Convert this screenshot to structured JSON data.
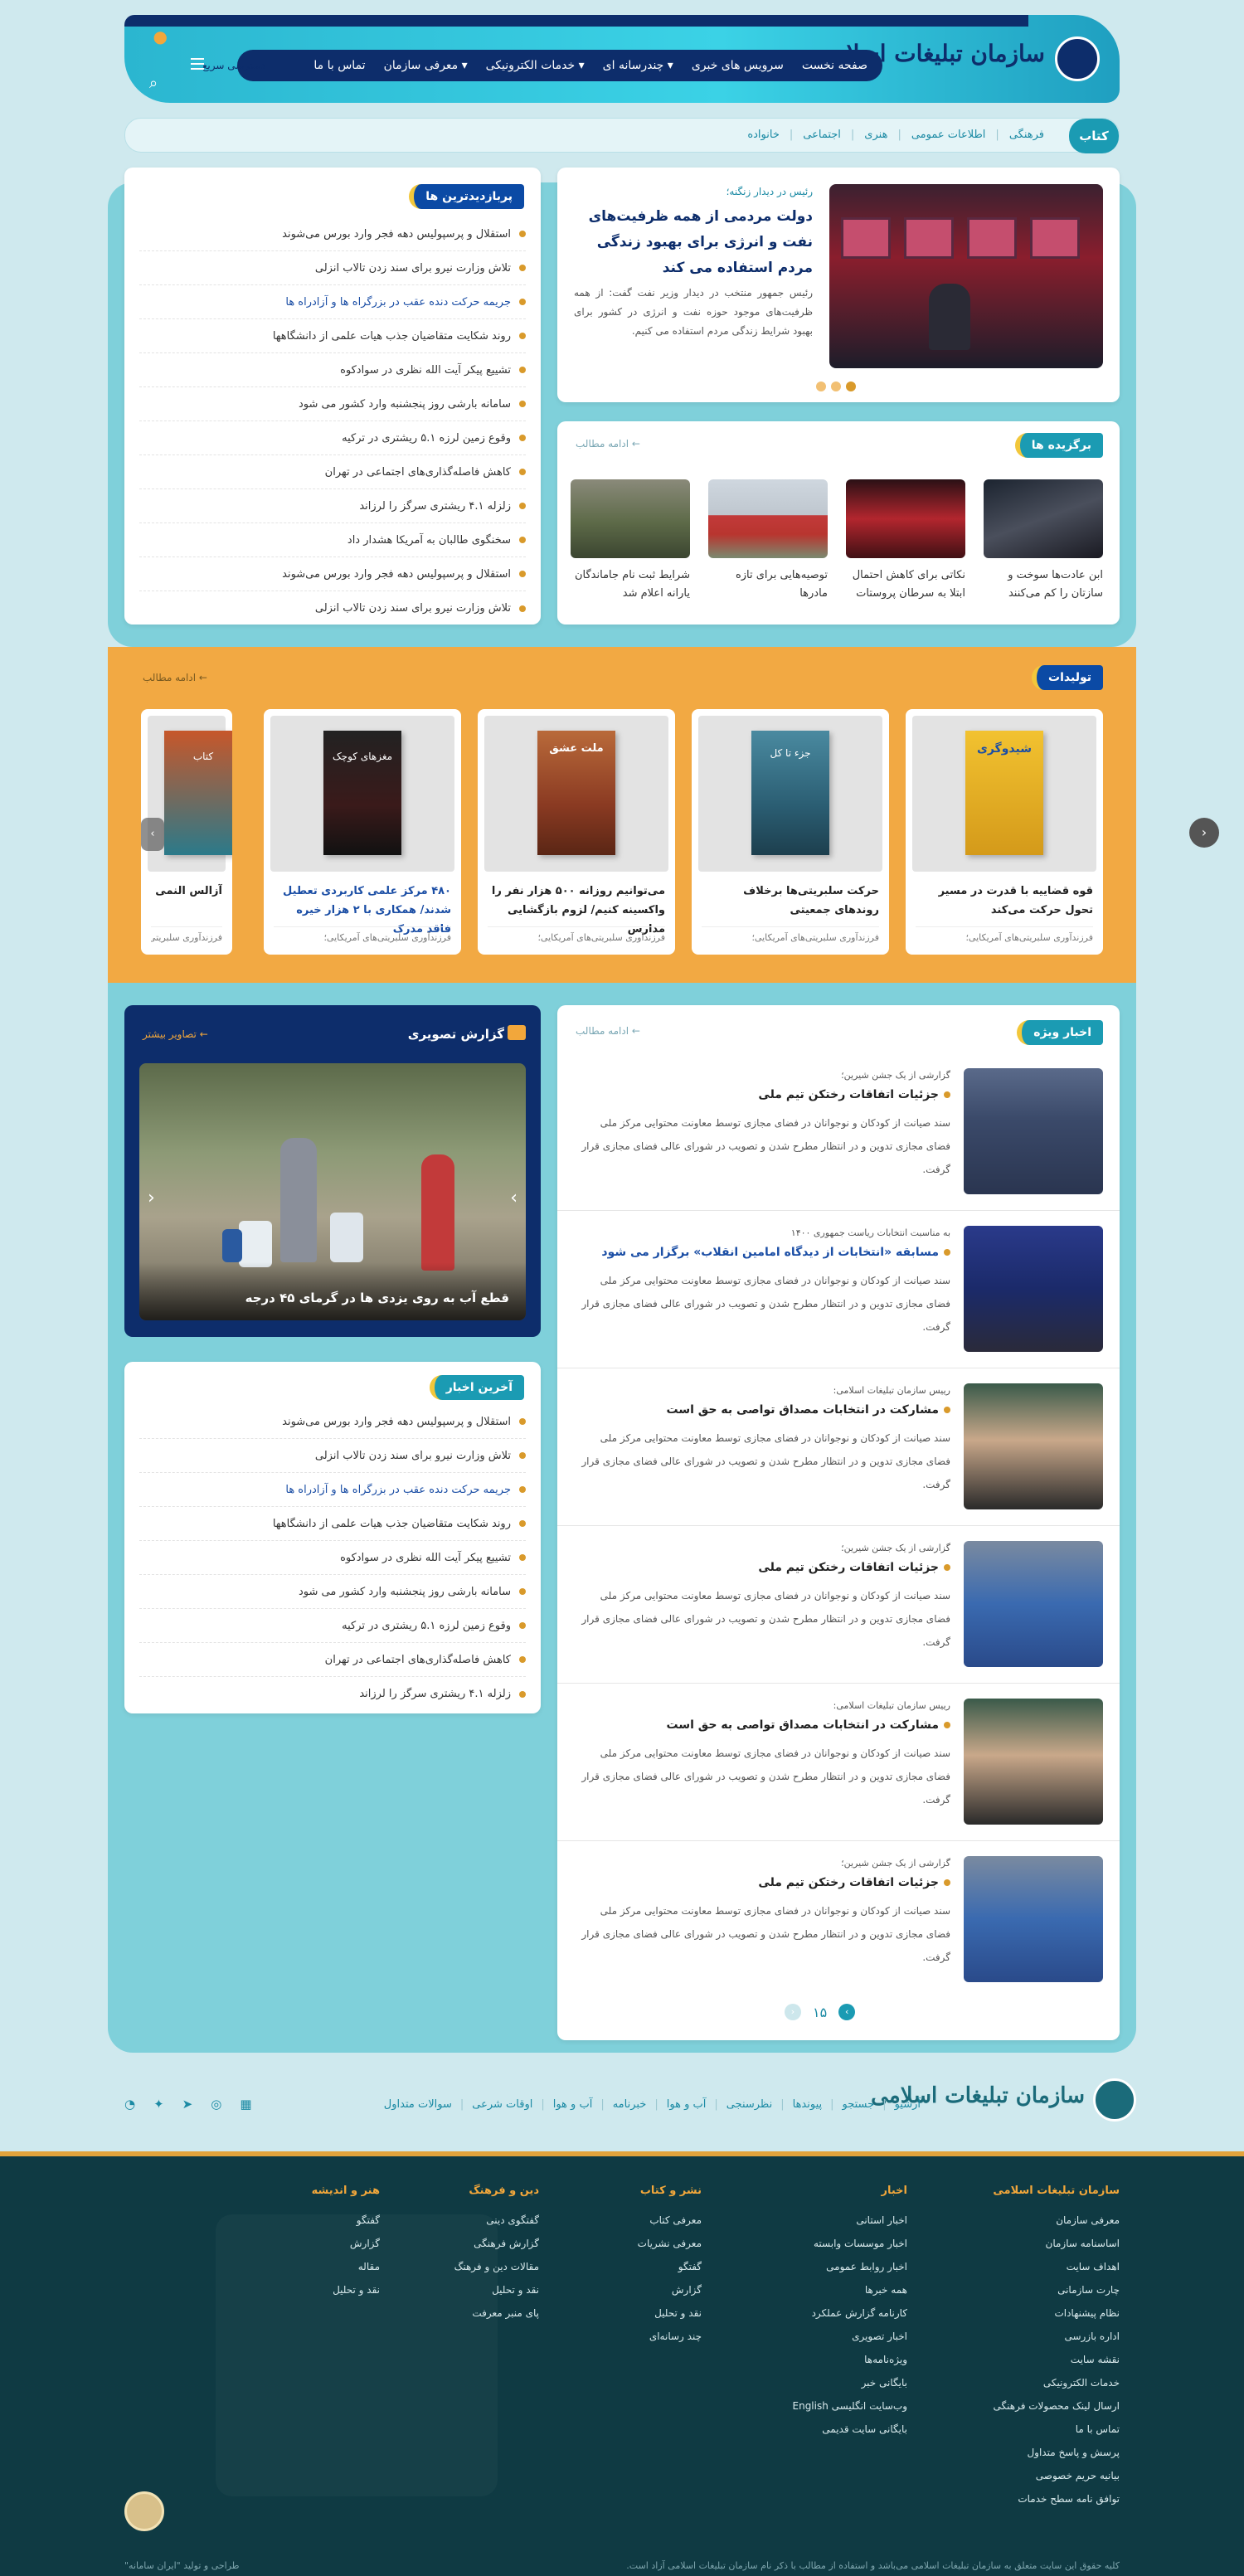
{
  "header": {
    "logo_text": "سازمان تبلیغات اسلامی",
    "nav": [
      "صفحه نخست",
      "سرویس های خبری",
      "چندرسانه ای",
      "خدمات الکترونیکی",
      "معرفی سازمان",
      "تماس با ما"
    ],
    "quick_access": "دسترسی سریع"
  },
  "subnav": {
    "head": "کتاب",
    "links": [
      "فرهنگی",
      "اطلاعات عمومی",
      "هنری",
      "اجتماعی",
      "خانواده"
    ]
  },
  "hero": {
    "kicker": "رئیس در دیدار زنگنه؛",
    "title": "دولت مردمی از همه ظرفیت‌های نفت و انرژی برای بهبود زندگی مردم استفاده می کند",
    "desc": "رئیس جمهور منتخب در دیدار وزیر نفت گفت: از همه ظرفیت‌های موجود حوزه نفت و انرژی در کشور برای بهبود شرایط زندگی مردم استفاده می کنیم."
  },
  "featured": {
    "title": "برگزیده ها",
    "more": "ادامه مطالب",
    "items": [
      "ابن عادت‌ها سوخت و سازتان را کم می‌کنند",
      "نکاتی برای کاهش احتمال ابتلا به سرطان پروستات",
      "توصیه‌هایی برای تازه مادرها",
      "شرایط ثبت نام جاماندگان یارانه اعلام شد"
    ]
  },
  "most_viewed": {
    "title": "پربازدیدترین ها",
    "items": [
      "استقلال و پرسپولیس دهه فجر وارد بورس می‌شوند",
      "تلاش وزارت نیرو برای سند زدن تالاب انزلی",
      "جریمه حرکت دنده عقب در بزرگراه ها و آزادراه ها",
      "روند شکایت متقاضیان جذب هیات علمی از دانشگاهها",
      "تشییع پیکر آیت الله نظری در سوادکوه",
      "سامانه بارشی روز پنجشنبه وارد کشور می شود",
      "وقوع زمین لرزه ۵.۱ ریشتری در ترکیه",
      "کاهش فاصله‌گذاری‌های اجتماعی در تهران",
      "زلزله ۴.۱ ریشتری سرگز را لرزاند",
      "سخنگوی طالبان به آمریکا هشدار داد",
      "استقلال و پرسپولیس دهه فجر وارد بورس می‌شوند",
      "تلاش وزارت نیرو برای سند زدن تالاب انزلی"
    ]
  },
  "products": {
    "title": "تولیدات",
    "more": "ادامه مطالب",
    "books": [
      {
        "title": "قوه قضاییه با قدرت در مسیر تحول حرکت می‌کند",
        "sub": "فرزندآوری سلبریتی‌های آمریکایی؛",
        "cover": "شیدوگری"
      },
      {
        "title": "حرکت سلبریتی‌ها برخلاف روندهای جمعیتی",
        "sub": "فرزندآوری سلبریتی‌های آمریکایی؛",
        "cover": "جزء تا کل"
      },
      {
        "title": "می‌توانیم روزانه ۵۰۰ هزار نفر را واکسینه کنیم/ لزوم بازگشایی مدارس",
        "sub": "فرزندآوری سلبریتی‌های آمریکایی؛",
        "cover": "ملت عشق"
      },
      {
        "title": "۴۸۰ مرکز علمی کاربردی تعطیل شدند/ همکاری با ۲ هزار خیره فاقد مدرک",
        "sub": "فرزندآوری سلبریتی‌های آمریکایی؛",
        "cover": "مغزهای کوچک"
      },
      {
        "title": "آزالس النمی مجری کتابخانه به دنبال توقف برنامه مقابل",
        "sub": "فرزندآوری سلبریتی‌های آمریکایی؛",
        "cover": "کتاب"
      }
    ]
  },
  "special_news": {
    "title": "اخبار ویژه",
    "more": "ادامه مطالب",
    "desc": "سند صیانت از کودکان و نوجوانان در فضای مجازی توسط معاونت محتوایی مرکز ملی فضای مجازی تدوین و در انتظار مطرح شدن و تصویب در شورای عالی فضای مجازی قرار گرفت.",
    "items": [
      {
        "kicker": "گزارشی از یک جشن شیرین؛",
        "title": "جزئیات اتفاقات رختکن تیم ملی"
      },
      {
        "kicker": "به مناسبت انتخابات ریاست جمهوری ۱۴۰۰",
        "title": "مسابقه «انتخابات از دیدگاه امامین انقلاب» برگزار می شود"
      },
      {
        "kicker": "رییس سازمان تبلیغات اسلامی:",
        "title": "مشارکت در انتخابات مصداق تواصی به حق است"
      },
      {
        "kicker": "گزارشی از یک جشن شیرین؛",
        "title": "جزئیات اتفاقات رختکن تیم ملی"
      },
      {
        "kicker": "رییس سازمان تبلیغات اسلامی:",
        "title": "مشارکت در انتخابات مصداق تواصی به حق است"
      },
      {
        "kicker": "گزارشی از یک جشن شیرین؛",
        "title": "جزئیات اتفاقات رختکن تیم ملی"
      }
    ],
    "page": "۱۵"
  },
  "photo_report": {
    "title": "گزارش تصویری",
    "more": "تصاویر بیشتر",
    "caption": "قطع آب به روی یزدی ها در گرمای ۴۵ درجه"
  },
  "latest": {
    "title": "آخرین اخبار",
    "items": [
      "استقلال و پرسپولیس دهه فجر وارد بورس می‌شوند",
      "تلاش وزارت نیرو برای سند زدن تالاب انزلی",
      "جریمه حرکت دنده عقب در بزرگراه ها و آزادراه ها",
      "روند شکایت متقاضیان جذب هیات علمی از دانشگاهها",
      "تشییع پیکر آیت الله نظری در سوادکوه",
      "سامانه بارشی روز پنجشنبه وارد کشور می شود",
      "وقوع زمین لرزه ۵.۱ ریشتری در ترکیه",
      "کاهش فاصله‌گذاری‌های اجتماعی در تهران",
      "زلزله ۴.۱ ریشتری سرگز را لرزاند"
    ]
  },
  "footer_bar": {
    "logo_text": "سازمان تبلیغات اسلامی",
    "links": [
      "آرشیو",
      "جستجو",
      "پیوندها",
      "نظرسنجی",
      "آب و هوا",
      "خبرنامه",
      "آب و هوا",
      "اوقات شرعی",
      "سوالات متداول"
    ]
  },
  "footer": {
    "columns": [
      {
        "title": "سازمان تبلیغات اسلامی",
        "links": [
          "معرفی سازمان",
          "اساسنامه سازمان",
          "اهداف سایت",
          "چارت سازمانی",
          "نظام پیشنهادات",
          "اداره بازرسی",
          "نقشه سایت",
          "خدمات الکترونیکی",
          "ارسال لینک محصولات فرهنگی",
          "تماس با ما",
          "پرسش و پاسخ متداول",
          "بیانیه حریم خصوصی",
          "توافق نامه سطح خدمات"
        ]
      },
      {
        "title": "اخبار",
        "links": [
          "اخبار استانی",
          "اخبار موسسات وابسته",
          "اخبار روابط عمومی",
          "همه خبرها",
          "کارنامه گزارش عملکرد",
          "اخبار تصویری",
          "ویژه‌نامه‌ها",
          "بایگانی خبر",
          "وب‌سایت انگلیسی English",
          "بایگانی سایت قدیمی"
        ]
      },
      {
        "title": "نشر و کتاب",
        "links": [
          "معرفی کتاب",
          "معرفی نشریات",
          "گفتگو",
          "گزارش",
          "نقد و تحلیل",
          "چند رسانه‌ای"
        ]
      },
      {
        "title": "دین و فرهنگ",
        "links": [
          "گفتگوی دینی",
          "گزارش فرهنگی",
          "مقالات دین و فرهنگ",
          "نقد و تحلیل",
          "پای منبر معرفت"
        ]
      },
      {
        "title": "هنر و اندیشه",
        "links": [
          "گفتگو",
          "گزارش",
          "مقاله",
          "نقد و تحلیل"
        ]
      }
    ],
    "copyright": "کلیه حقوق این سایت متعلق به سازمان تبلیغات اسلامی می‌باشد و استفاده از مطالب با ذکر نام سازمان تبلیغات اسلامی آزاد است.",
    "credit": "طراحی و تولید \"ایران سامانه\""
  },
  "colors": {
    "navy": "#0d2d6b",
    "teal": "#1b9bb3",
    "orange": "#f2a943",
    "footer": "#0f3a43"
  }
}
